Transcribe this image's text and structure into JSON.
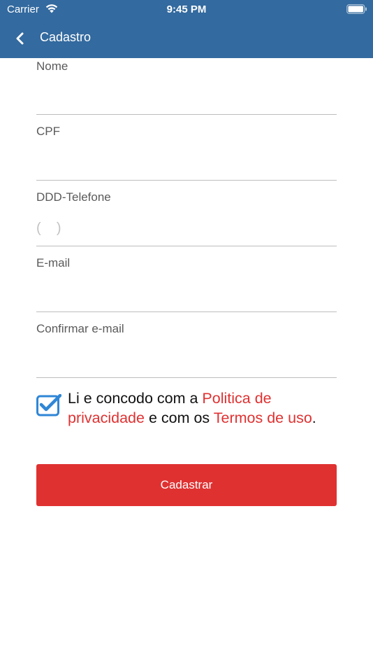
{
  "status_bar": {
    "carrier": "Carrier",
    "time": "9:45 PM",
    "wifi_icon": "wifi-icon",
    "battery_icon": "battery-icon"
  },
  "nav": {
    "back_icon": "chevron-left-icon",
    "title": "Cadastro"
  },
  "form": {
    "fields": [
      {
        "label": "Nome",
        "value": "",
        "placeholder": ""
      },
      {
        "label": "CPF",
        "value": "",
        "placeholder": ""
      },
      {
        "label": "DDD-Telefone",
        "value": "",
        "placeholder": "(    )"
      },
      {
        "label": "E-mail",
        "value": "",
        "placeholder": ""
      },
      {
        "label": "Confirmar e-mail",
        "value": "",
        "placeholder": ""
      }
    ]
  },
  "terms": {
    "checked": true,
    "text_1": "Li e concodo com a ",
    "link_privacy": "Politica de privacidade",
    "text_2": " e com os ",
    "link_terms": "Termos de uso",
    "text_3": "."
  },
  "submit": {
    "label": "Cadastrar"
  },
  "colors": {
    "header": "#336a9f",
    "accent_red": "#e03131",
    "checkbox_blue": "#2f86d6"
  }
}
